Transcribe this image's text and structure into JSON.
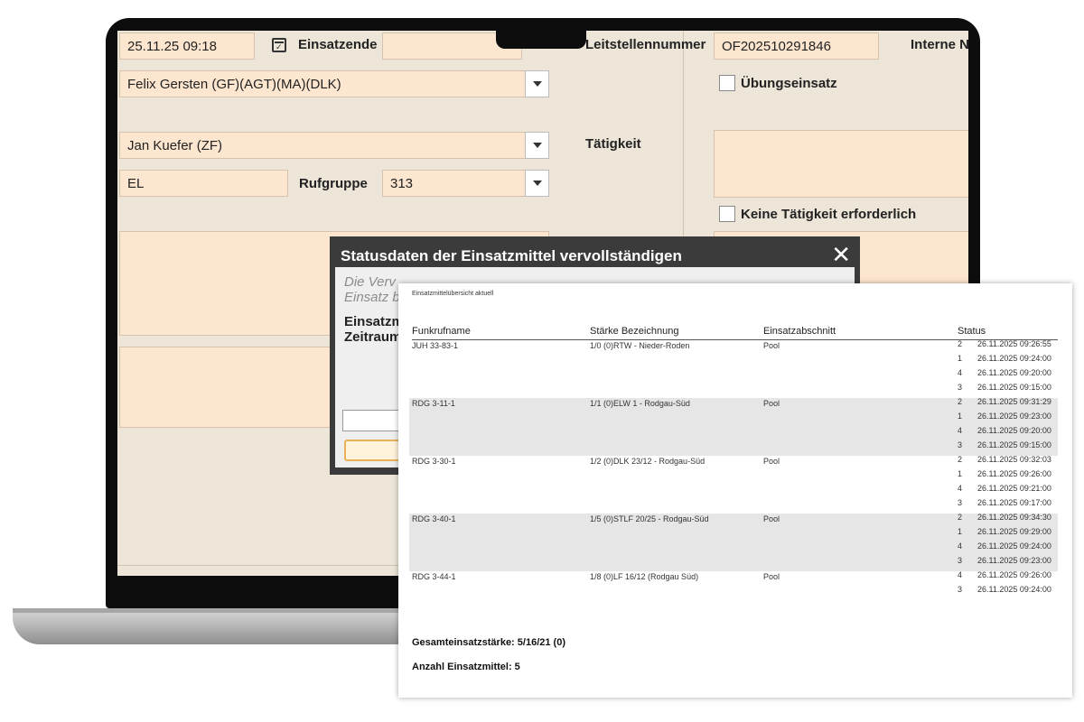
{
  "form": {
    "start_time": "25.11.25 09:18",
    "einsatzende_label": "Einsatzende",
    "einsatzende_value": "",
    "person1": "Felix Gersten (GF)(AGT)(MA)(DLK)",
    "person2": "Jan Kuefer (ZF)",
    "el_value": "EL",
    "rufgruppe_label": "Rufgruppe",
    "rufgruppe_value": "313",
    "leitstellennummer_label": "Leitstellennummer",
    "leitstellennummer_value": "OF202510291846",
    "interne_label": "Interne N",
    "uebungseinsatz_label": "Übungseinsatz",
    "taetigkeit_label": "Tätigkeit",
    "keine_taetigkeit_label": "Keine Tätigkeit erforderlich"
  },
  "dialog": {
    "title": "Statusdaten der Einsatzmittel vervollständigen",
    "close_symbol": "✕",
    "italic_line1": "Die Verv",
    "italic_line2": "Einsatz b",
    "bold_line1": "Einsatzm",
    "bold_line2": "Zeitraum"
  },
  "report": {
    "caption": "Einsatzmittelübersicht aktuell",
    "columns": [
      "Funkrufname",
      "Stärke Bezeichnung",
      "Einsatzabschnitt",
      "Status"
    ],
    "rows": [
      {
        "funkrufname": "JUH 33-83-1",
        "staerke": "1/0 (0)RTW - Nieder-Roden",
        "abschnitt": "Pool",
        "status": [
          [
            "2",
            "26.11.2025 09:26:55"
          ],
          [
            "1",
            "26.11.2025 09:24:00"
          ],
          [
            "4",
            "26.11.2025 09:20:00"
          ],
          [
            "3",
            "26.11.2025 09:15:00"
          ]
        ]
      },
      {
        "funkrufname": "RDG 3-11-1",
        "staerke": "1/1 (0)ELW 1 - Rodgau-Süd",
        "abschnitt": "Pool",
        "status": [
          [
            "2",
            "26.11.2025 09:31:29"
          ],
          [
            "1",
            "26.11.2025 09:23:00"
          ],
          [
            "4",
            "26.11.2025 09:20:00"
          ],
          [
            "3",
            "26.11.2025 09:15:00"
          ]
        ]
      },
      {
        "funkrufname": "RDG 3-30-1",
        "staerke": "1/2 (0)DLK 23/12 - Rodgau-Süd",
        "abschnitt": "Pool",
        "status": [
          [
            "2",
            "26.11.2025 09:32:03"
          ],
          [
            "1",
            "26.11.2025 09:26:00"
          ],
          [
            "4",
            "26.11.2025 09:21:00"
          ],
          [
            "3",
            "26.11.2025 09:17:00"
          ]
        ]
      },
      {
        "funkrufname": "RDG 3-40-1",
        "staerke": "1/5 (0)STLF 20/25 - Rodgau-Süd",
        "abschnitt": "Pool",
        "status": [
          [
            "2",
            "26.11.2025 09:34:30"
          ],
          [
            "1",
            "26.11.2025 09:29:00"
          ],
          [
            "4",
            "26.11.2025 09:24:00"
          ],
          [
            "3",
            "26.11.2025 09:23:00"
          ]
        ]
      },
      {
        "funkrufname": "RDG 3-44-1",
        "staerke": "1/8 (0)LF 16/12 (Rodgau Süd)",
        "abschnitt": "Pool",
        "status": [
          [
            "4",
            "26.11.2025 09:26:00"
          ],
          [
            "3",
            "26.11.2025 09:24:00"
          ]
        ]
      }
    ],
    "total_strength": "Gesamteinsatzstärke: 5/16/21 (0)",
    "total_units": "Anzahl Einsatzmittel: 5"
  }
}
